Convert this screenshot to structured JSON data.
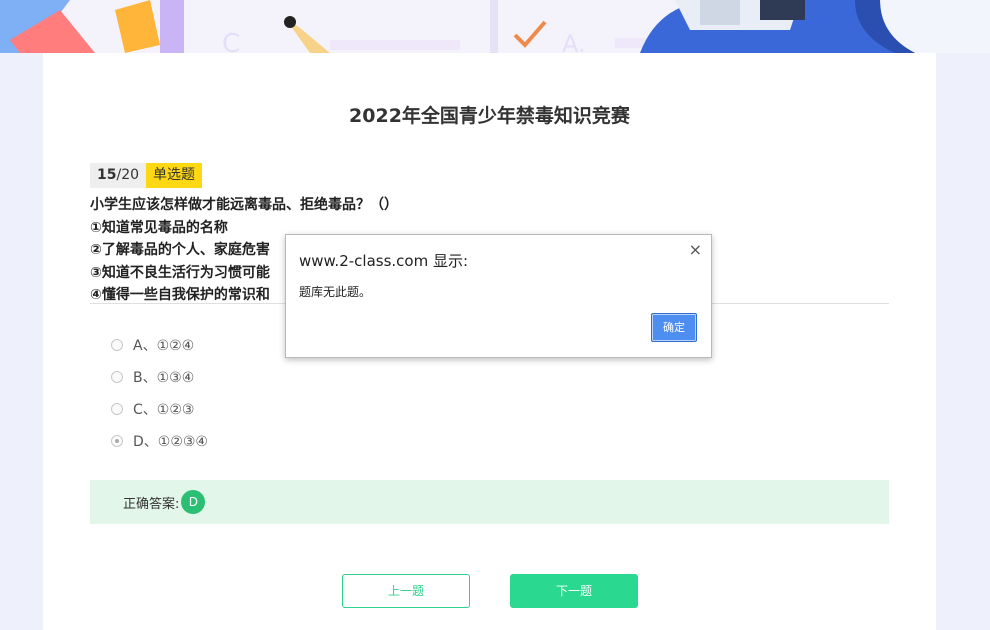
{
  "page": {
    "title": "2022年全国青少年禁毒知识竞赛"
  },
  "question": {
    "current": "15",
    "total": "/20",
    "type": "单选题",
    "lines": [
      "小学生应该怎样做才能远离毒品、拒绝毒品？（）",
      "①知道常见毒品的名称",
      "②了解毒品的个人、家庭危害",
      "③知道不良生活行为习惯可能",
      "④懂得一些自我保护的常识和"
    ]
  },
  "options": [
    {
      "label": "A、①②④",
      "selected": false
    },
    {
      "label": "B、①③④",
      "selected": false
    },
    {
      "label": "C、①②③",
      "selected": false
    },
    {
      "label": "D、①②③④",
      "selected": true
    }
  ],
  "answer": {
    "label": "正确答案:",
    "value": "D"
  },
  "buttons": {
    "prev": "上一题",
    "next": "下一题"
  },
  "dialog": {
    "title": "www.2-class.com 显示:",
    "message": "题库无此题。",
    "ok": "确定",
    "close": "×"
  },
  "colors": {
    "accent": "#2ad98f",
    "answer_bg": "#e2f6ea",
    "badge": "#2bbf73",
    "type_tag": "#ffd814",
    "dialog_button": "#4d8ef0"
  }
}
